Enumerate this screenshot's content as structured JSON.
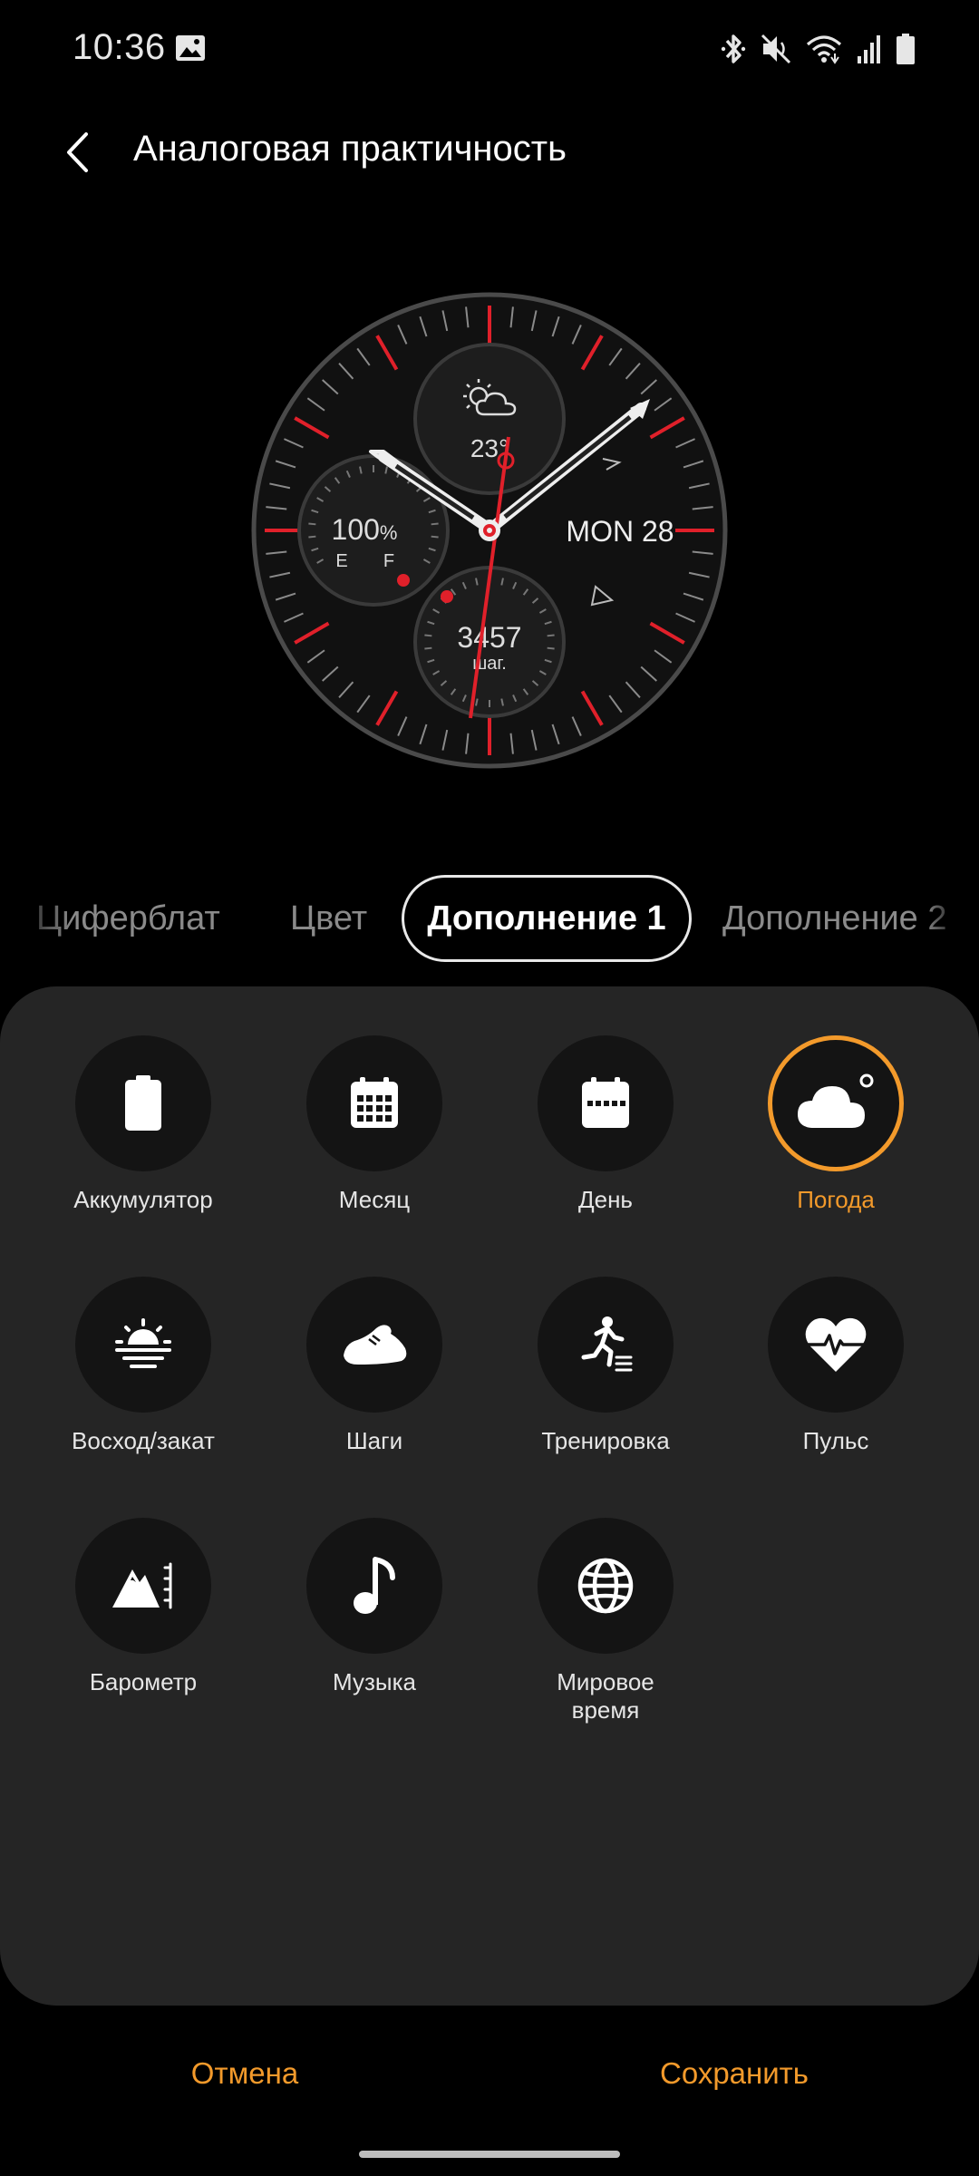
{
  "status_bar": {
    "time": "10:36",
    "icons": [
      "gallery-icon",
      "bluetooth-icon",
      "mute-icon",
      "wifi-icon",
      "signal-icon",
      "battery-icon"
    ]
  },
  "header": {
    "title": "Аналоговая практичность",
    "back_icon": "chevron-left-icon"
  },
  "watch": {
    "weather_temp": "23°",
    "battery_value": "100",
    "battery_unit": "%",
    "fuel_e": "E",
    "fuel_f": "F",
    "date": "MON 28",
    "steps_value": "3457",
    "steps_unit": "шаг.",
    "accent_color": "#e0202a"
  },
  "tabs": [
    {
      "label": "Циферблат",
      "active": false
    },
    {
      "label": "Цвет",
      "active": false
    },
    {
      "label": "Дополнение 1",
      "active": true
    },
    {
      "label": "Дополнение 2",
      "active": false
    }
  ],
  "complications": [
    {
      "label": "Аккумулятор",
      "icon": "battery-icon",
      "selected": false
    },
    {
      "label": "Месяц",
      "icon": "calendar-month-icon",
      "selected": false
    },
    {
      "label": "День",
      "icon": "calendar-day-icon",
      "selected": false
    },
    {
      "label": "Погода",
      "icon": "weather-cloud-icon",
      "selected": true
    },
    {
      "label": "Восход/закат",
      "icon": "sunrise-icon",
      "selected": false
    },
    {
      "label": "Шаги",
      "icon": "shoe-icon",
      "selected": false
    },
    {
      "label": "Тренировка",
      "icon": "running-icon",
      "selected": false
    },
    {
      "label": "Пульс",
      "icon": "heart-rate-icon",
      "selected": false
    },
    {
      "label": "Барометр",
      "icon": "barometer-icon",
      "selected": false
    },
    {
      "label": "Музыка",
      "icon": "music-note-icon",
      "selected": false
    },
    {
      "label": "Мировое время",
      "icon": "globe-icon",
      "selected": false
    }
  ],
  "buttons": {
    "cancel": "Отмена",
    "save": "Сохранить"
  },
  "colors": {
    "accent": "#f39a2b",
    "panel": "#252525",
    "circle": "#141414"
  }
}
